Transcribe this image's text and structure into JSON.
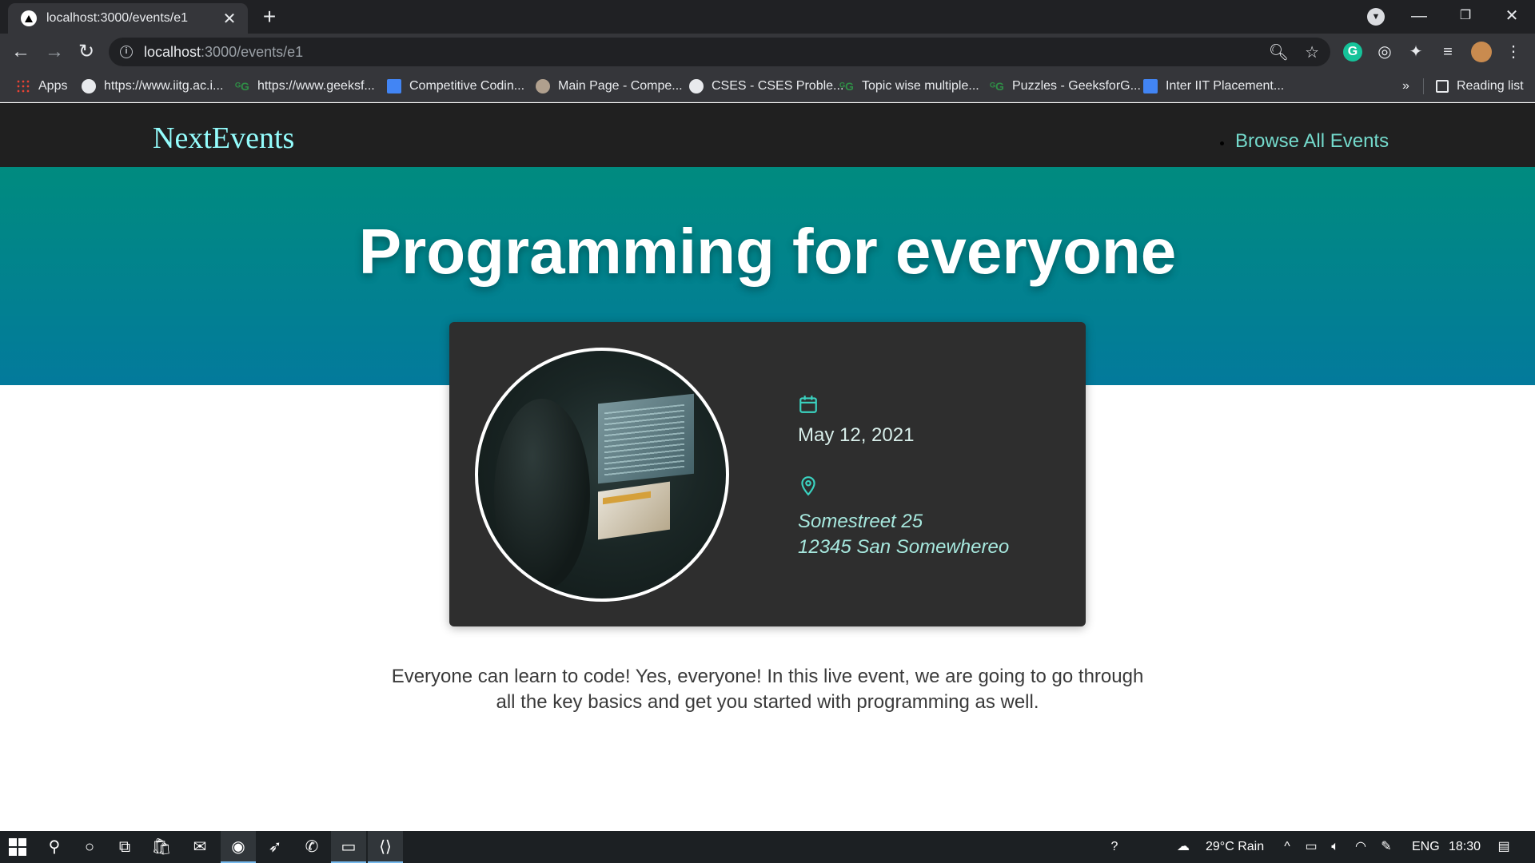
{
  "browser": {
    "tab_title": "localhost:3000/events/e1",
    "url_host": "localhost",
    "url_path": ":3000/events/e1",
    "bookmarks": [
      {
        "label": "Apps",
        "icon": "apps-icon"
      },
      {
        "label": "https://www.iitg.ac.i...",
        "icon": "globe-icon"
      },
      {
        "label": "https://www.geeksf...",
        "icon": "gfg-icon"
      },
      {
        "label": "Competitive Codin...",
        "icon": "doc-icon"
      },
      {
        "label": "Main Page - Compe...",
        "icon": "cf-icon"
      },
      {
        "label": "CSES - CSES Proble...",
        "icon": "globe-icon"
      },
      {
        "label": "Topic wise multiple...",
        "icon": "gfg-icon"
      },
      {
        "label": "Puzzles - GeeksforG...",
        "icon": "gfg-icon"
      },
      {
        "label": "Inter IIT Placement...",
        "icon": "doc-icon"
      }
    ],
    "more_bookmarks": "»",
    "reading_list": "Reading list"
  },
  "site": {
    "logo": "NextEvents",
    "nav_link": "Browse All Events"
  },
  "event": {
    "title": "Programming for everyone",
    "date": "May 12, 2021",
    "address_line1": "Somestreet 25",
    "address_line2": "12345 San Somewhereo",
    "description": "Everyone can learn to code! Yes, everyone! In this live event, we are going to go through all the key basics and get you started with programming as well."
  },
  "taskbar": {
    "weather": "29°C  Rain",
    "language": "ENG",
    "time": "18:30"
  },
  "colors": {
    "accent": "#74dacc",
    "logo": "#94fdfd",
    "hero_top": "#008b7f",
    "hero_bottom": "#037a9c",
    "card": "#2e2e2e"
  }
}
